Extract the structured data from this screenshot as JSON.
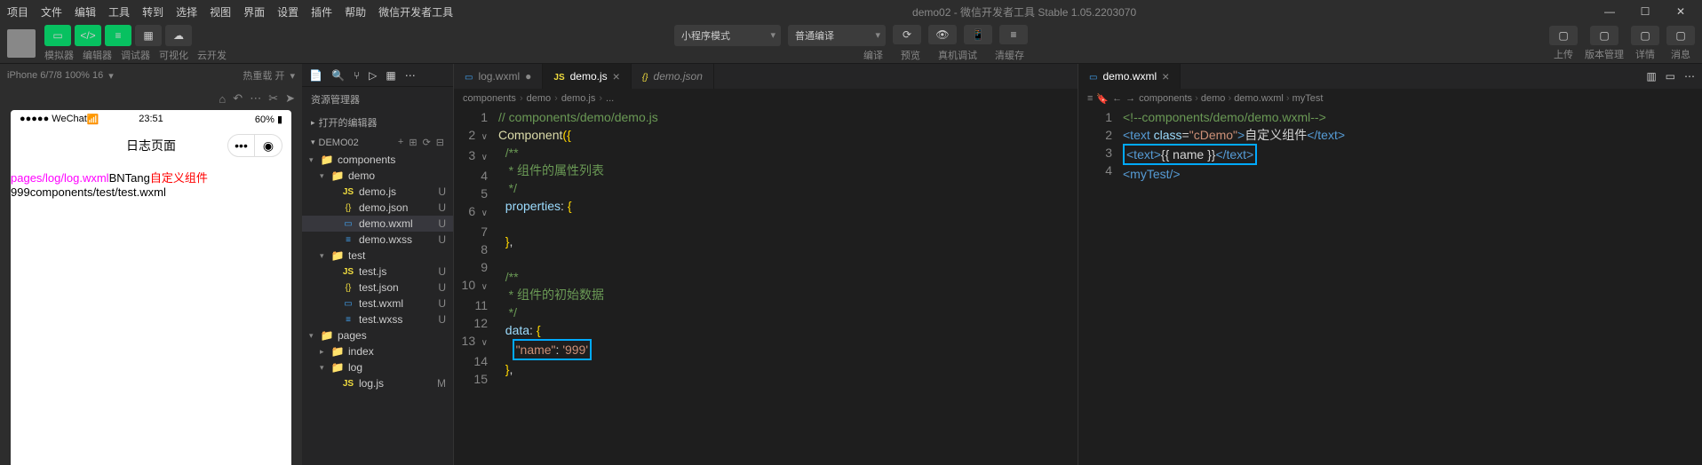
{
  "window": {
    "title": "demo02 - 微信开发者工具 Stable 1.05.2203070"
  },
  "menu": {
    "items": [
      "项目",
      "文件",
      "编辑",
      "工具",
      "转到",
      "选择",
      "视图",
      "界面",
      "设置",
      "插件",
      "帮助",
      "微信开发者工具"
    ]
  },
  "toolbar": {
    "left_labels": [
      "模拟器",
      "编辑器",
      "调试器",
      "可视化",
      "云开发"
    ],
    "mode_select": "小程序模式",
    "compile_select": "普通编译",
    "center_labels": [
      "编译",
      "预览",
      "真机调试",
      "清缓存"
    ],
    "right_labels": [
      "上传",
      "版本管理",
      "详情",
      "消息"
    ]
  },
  "simulator": {
    "device": "iPhone 6/7/8 100% 16",
    "hot": "热重载 开",
    "phone": {
      "wechat": "●●●●● WeChat",
      "time": "23:51",
      "battery": "60%",
      "nav_title": "日志页面",
      "line1_a": "pages/log/log.wxml",
      "line1_b": "BNTang",
      "line1_c": "自定义组件",
      "line2": "999components/test/test.wxml"
    }
  },
  "explorer": {
    "title": "资源管理器",
    "open_editors": "打开的编辑器",
    "project": "DEMO02",
    "tree": [
      {
        "type": "folder",
        "label": "components",
        "indent": 0,
        "chev": "▾"
      },
      {
        "type": "folder",
        "label": "demo",
        "indent": 1,
        "chev": "▾"
      },
      {
        "type": "file",
        "label": "demo.js",
        "indent": 2,
        "ico": "js",
        "status": "U"
      },
      {
        "type": "file",
        "label": "demo.json",
        "indent": 2,
        "ico": "json",
        "status": "U"
      },
      {
        "type": "file",
        "label": "demo.wxml",
        "indent": 2,
        "ico": "wxml",
        "status": "U",
        "active": true
      },
      {
        "type": "file",
        "label": "demo.wxss",
        "indent": 2,
        "ico": "wxss",
        "status": "U"
      },
      {
        "type": "folder",
        "label": "test",
        "indent": 1,
        "chev": "▾"
      },
      {
        "type": "file",
        "label": "test.js",
        "indent": 2,
        "ico": "js",
        "status": "U"
      },
      {
        "type": "file",
        "label": "test.json",
        "indent": 2,
        "ico": "json",
        "status": "U"
      },
      {
        "type": "file",
        "label": "test.wxml",
        "indent": 2,
        "ico": "wxml",
        "status": "U"
      },
      {
        "type": "file",
        "label": "test.wxss",
        "indent": 2,
        "ico": "wxss",
        "status": "U"
      },
      {
        "type": "folder",
        "label": "pages",
        "indent": 0,
        "chev": "▾"
      },
      {
        "type": "folder",
        "label": "index",
        "indent": 1,
        "chev": "▸"
      },
      {
        "type": "folder",
        "label": "log",
        "indent": 1,
        "chev": "▾"
      },
      {
        "type": "file",
        "label": "log.js",
        "indent": 2,
        "ico": "js",
        "status": "M"
      }
    ]
  },
  "editor1": {
    "tabs": [
      {
        "label": "log.wxml",
        "ico": "wxml",
        "dirty": true
      },
      {
        "label": "demo.js",
        "ico": "js",
        "active": true
      },
      {
        "label": "demo.json",
        "ico": "json",
        "italic": true
      }
    ],
    "breadcrumb": [
      "components",
      "demo",
      "demo.js",
      "..."
    ],
    "lines": [
      {
        "n": 1,
        "html": "<span class='c-comment'>// components/demo/demo.js</span>"
      },
      {
        "n": 2,
        "html": "<span class='c-func'>Component</span><span class='c-brace'>(</span><span class='c-brace'>{</span>",
        "fold": "∨"
      },
      {
        "n": 3,
        "html": "  <span class='c-comment'>/**</span>",
        "fold": "∨"
      },
      {
        "n": 4,
        "html": "   <span class='c-comment'>* 组件的属性列表</span>"
      },
      {
        "n": 5,
        "html": "   <span class='c-comment'>*/</span>"
      },
      {
        "n": 6,
        "html": "  <span class='c-prop'>properties</span><span class='c-white'>: </span><span class='c-brace'>{</span>",
        "fold": "∨"
      },
      {
        "n": 7,
        "html": ""
      },
      {
        "n": 8,
        "html": "  <span class='c-brace'>}</span><span class='c-white'>,</span>"
      },
      {
        "n": 9,
        "html": ""
      },
      {
        "n": 10,
        "html": "  <span class='c-comment'>/**</span>",
        "fold": "∨"
      },
      {
        "n": 11,
        "html": "   <span class='c-comment'>* 组件的初始数据</span>"
      },
      {
        "n": 12,
        "html": "   <span class='c-comment'>*/</span>"
      },
      {
        "n": 13,
        "html": "  <span class='c-prop'>data</span><span class='c-white'>: </span><span class='c-brace'>{</span>",
        "fold": "∨"
      },
      {
        "n": 14,
        "html": "    <span class='highlight-box'><span class='c-string'>\"name\"</span><span class='c-white'>: </span><span class='c-string'>'999'</span></span>"
      },
      {
        "n": 15,
        "html": "  <span class='c-brace'>}</span><span class='c-white'>,</span>"
      }
    ]
  },
  "editor2": {
    "tabs": [
      {
        "label": "demo.wxml",
        "ico": "wxml",
        "active": true
      }
    ],
    "breadcrumb": [
      "components",
      "demo",
      "demo.wxml",
      "myTest"
    ],
    "lines": [
      {
        "n": 1,
        "html": "<span class='c-comment'>&lt;!--components/demo/demo.wxml--&gt;</span>"
      },
      {
        "n": 2,
        "html": "<span class='c-tag'>&lt;text</span> <span class='c-attr'>class</span>=<span class='c-string'>\"cDemo\"</span><span class='c-tag'>&gt;</span><span class='c-white'>自定义组件</span><span class='c-tag'>&lt;/text&gt;</span>"
      },
      {
        "n": 3,
        "html": "<span class='highlight-box'><span class='c-tag'>&lt;text&gt;</span><span class='c-white'>{{ name }}</span><span class='c-tag'>&lt;/text&gt;</span></span>"
      },
      {
        "n": 4,
        "html": "<span class='c-tag'>&lt;myTest/&gt;</span>"
      }
    ]
  }
}
